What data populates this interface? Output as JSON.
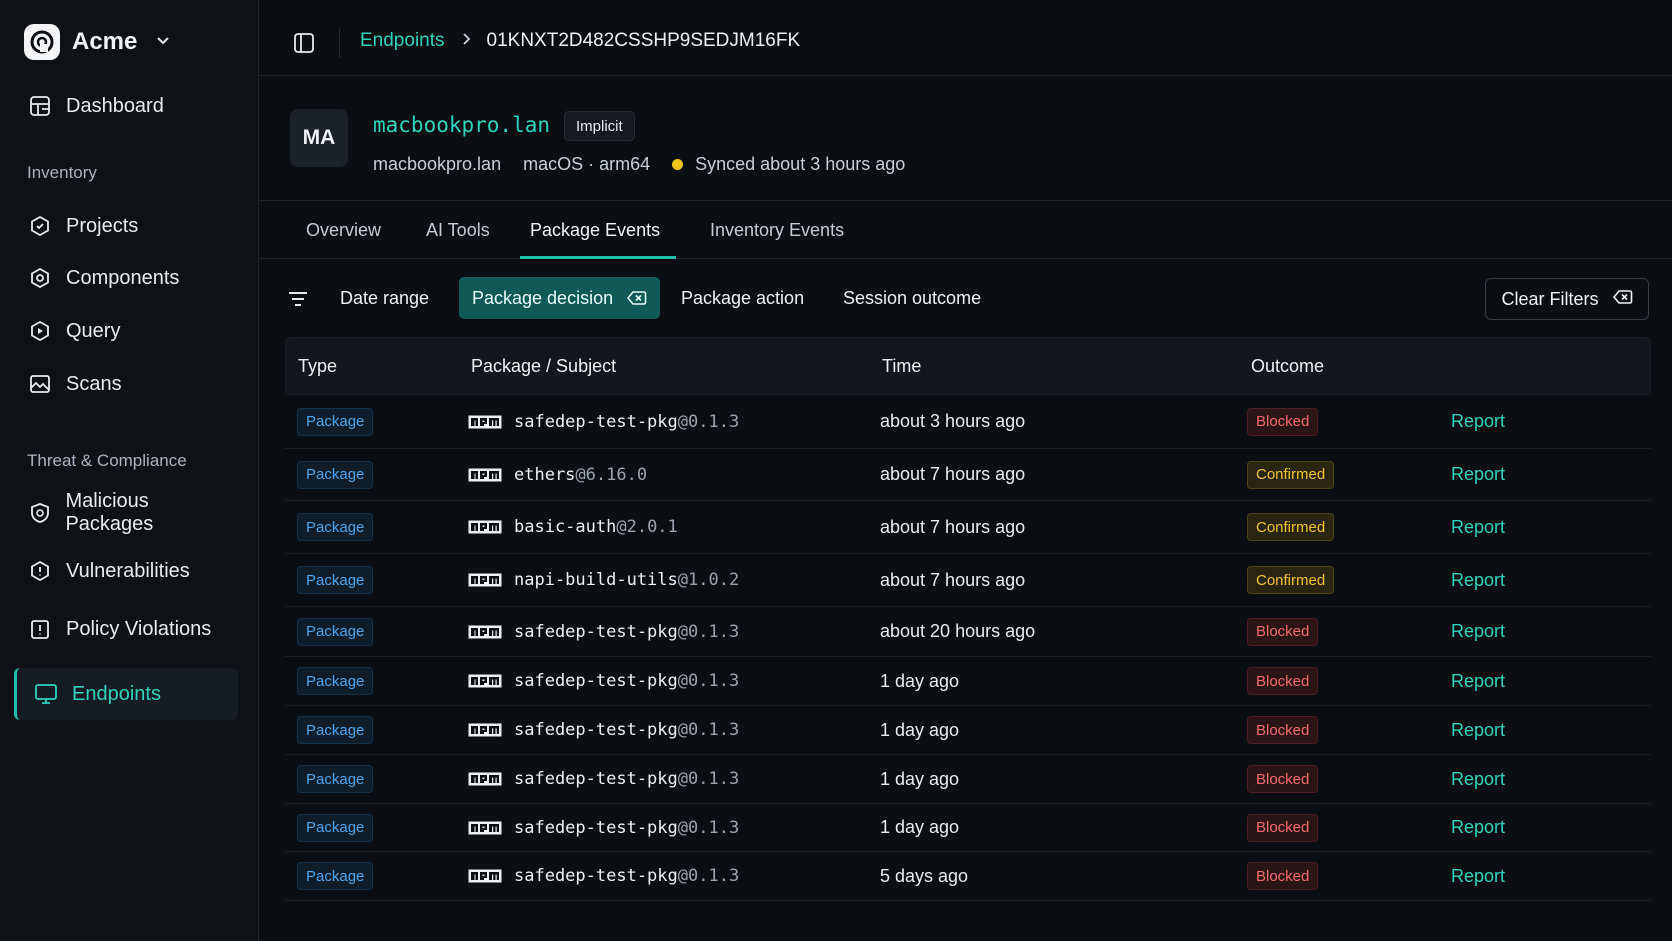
{
  "brand": {
    "name": "Acme"
  },
  "sidebar": {
    "dashboard": "Dashboard",
    "sections": [
      "Inventory",
      "Threat & Compliance"
    ],
    "inventory_items": [
      "Projects",
      "Components",
      "Query",
      "Scans"
    ],
    "threat_items": [
      "Malicious Packages",
      "Vulnerabilities",
      "Policy Violations"
    ],
    "active_item": "Endpoints"
  },
  "breadcrumb": {
    "parent": "Endpoints",
    "current": "01KNXT2D482CSSHP9SEDJM16FK"
  },
  "endpoint": {
    "avatar": "MA",
    "title": "macbookpro.lan",
    "badge": "Implicit",
    "hostname": "macbookpro.lan",
    "platform": "macOS · arm64",
    "sync": "Synced about 3 hours ago",
    "sync_color": "#f0c419"
  },
  "tabs": [
    "Overview",
    "AI Tools",
    "Package Events",
    "Inventory Events"
  ],
  "active_tab": "Package Events",
  "filters": {
    "date_range": "Date range",
    "package_decision": "Package decision",
    "package_action": "Package action",
    "session_outcome": "Session outcome",
    "clear": "Clear Filters"
  },
  "table": {
    "headers": [
      "Type",
      "Package / Subject",
      "Time",
      "Outcome"
    ],
    "rows": [
      {
        "type": "Package",
        "name": "safedep-test-pkg",
        "version": "@0.1.3",
        "time": "about 3 hours ago",
        "outcome": "Blocked",
        "action": "Report"
      },
      {
        "type": "Package",
        "name": "ethers",
        "version": "@6.16.0",
        "time": "about 7 hours ago",
        "outcome": "Confirmed",
        "action": "Report"
      },
      {
        "type": "Package",
        "name": "basic-auth",
        "version": "@2.0.1",
        "time": "about 7 hours ago",
        "outcome": "Confirmed",
        "action": "Report"
      },
      {
        "type": "Package",
        "name": "napi-build-utils",
        "version": "@1.0.2",
        "time": "about 7 hours ago",
        "outcome": "Confirmed",
        "action": "Report"
      },
      {
        "type": "Package",
        "name": "safedep-test-pkg",
        "version": "@0.1.3",
        "time": "about 20 hours ago",
        "outcome": "Blocked",
        "action": "Report"
      },
      {
        "type": "Package",
        "name": "safedep-test-pkg",
        "version": "@0.1.3",
        "time": "1 day ago",
        "outcome": "Blocked",
        "action": "Report"
      },
      {
        "type": "Package",
        "name": "safedep-test-pkg",
        "version": "@0.1.3",
        "time": "1 day ago",
        "outcome": "Blocked",
        "action": "Report"
      },
      {
        "type": "Package",
        "name": "safedep-test-pkg",
        "version": "@0.1.3",
        "time": "1 day ago",
        "outcome": "Blocked",
        "action": "Report"
      },
      {
        "type": "Package",
        "name": "safedep-test-pkg",
        "version": "@0.1.3",
        "time": "1 day ago",
        "outcome": "Blocked",
        "action": "Report"
      },
      {
        "type": "Package",
        "name": "safedep-test-pkg",
        "version": "@0.1.3",
        "time": "5 days ago",
        "outcome": "Blocked",
        "action": "Report"
      }
    ]
  },
  "colors": {
    "accent": "#2fd3bd",
    "blocked": "#f06a6a",
    "confirmed": "#f2c230",
    "type_badge": "#4fa3ea"
  }
}
